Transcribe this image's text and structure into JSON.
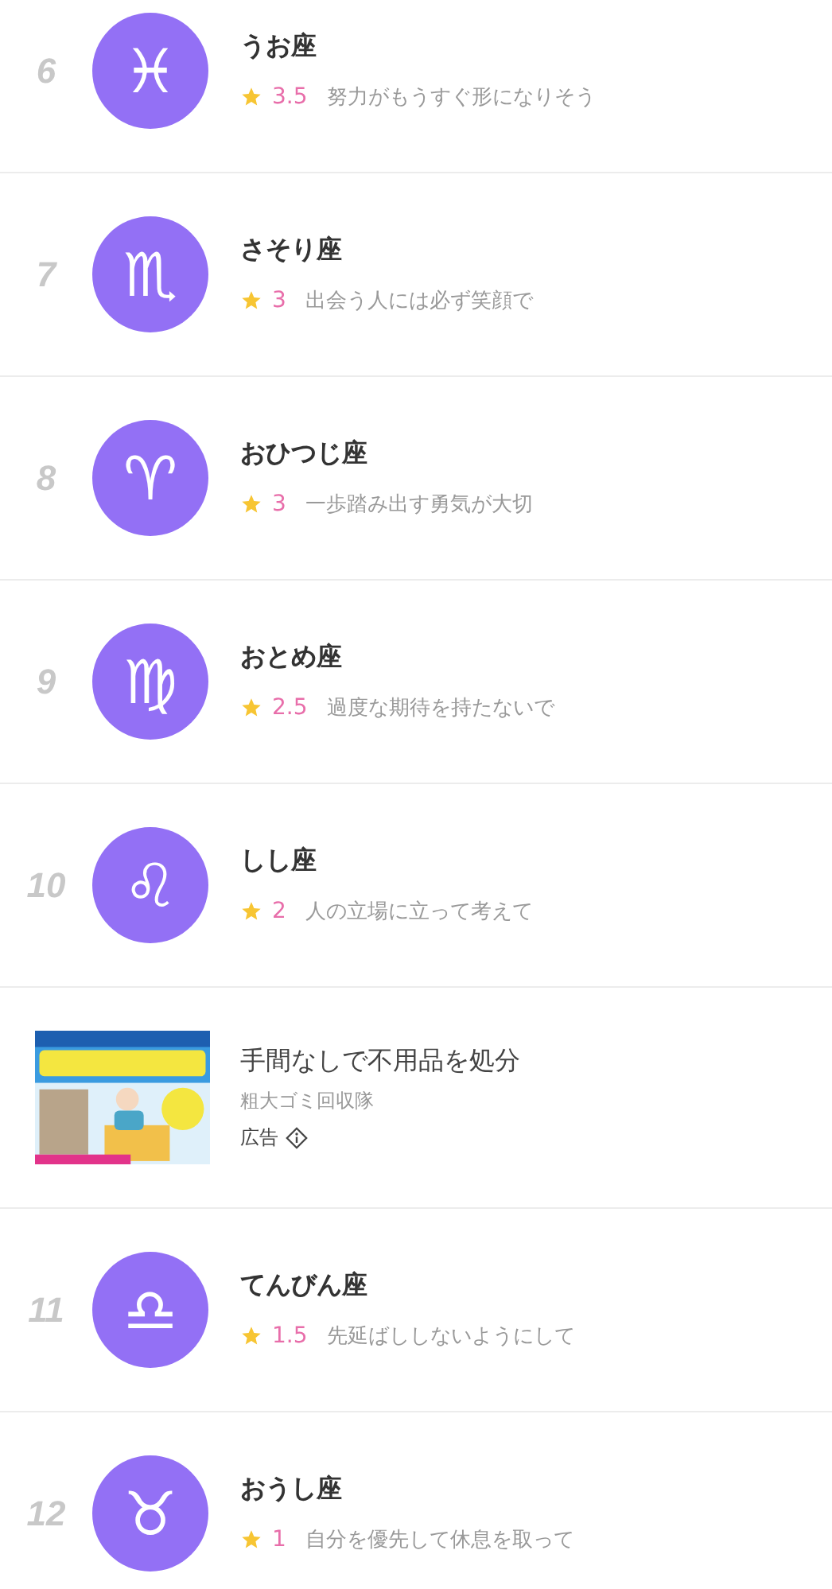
{
  "ranking": [
    {
      "kind": "sign",
      "rank": "6",
      "symbol": "♓",
      "name": "うお座",
      "rating": "3.5",
      "message": "努力がもうすぐ形になりそう"
    },
    {
      "kind": "sign",
      "rank": "7",
      "symbol": "♏",
      "name": "さそり座",
      "rating": "3",
      "message": "出会う人には必ず笑顔で"
    },
    {
      "kind": "sign",
      "rank": "8",
      "symbol": "♈",
      "name": "おひつじ座",
      "rating": "3",
      "message": "一歩踏み出す勇気が大切"
    },
    {
      "kind": "sign",
      "rank": "9",
      "symbol": "♍",
      "name": "おとめ座",
      "rating": "2.5",
      "message": "過度な期待を持たないで"
    },
    {
      "kind": "sign",
      "rank": "10",
      "symbol": "♌",
      "name": "しし座",
      "rating": "2",
      "message": "人の立場に立って考えて"
    },
    {
      "kind": "ad",
      "title": "手間なしで不用品を処分",
      "advertiser": "粗大ゴミ回収隊",
      "label": "広告"
    },
    {
      "kind": "sign",
      "rank": "11",
      "symbol": "♎",
      "name": "てんびん座",
      "rating": "1.5",
      "message": "先延ばししないようにして"
    },
    {
      "kind": "sign",
      "rank": "12",
      "symbol": "♉",
      "name": "おうし座",
      "rating": "1",
      "message": "自分を優先して休息を取って"
    }
  ]
}
